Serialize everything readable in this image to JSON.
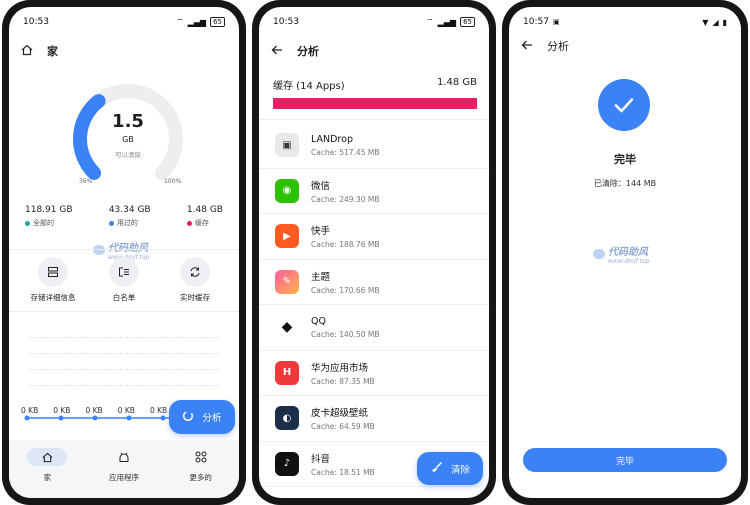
{
  "phone1": {
    "status_time": "10:53",
    "battery": "65",
    "header_title": "家",
    "gauge": {
      "value": "1.5",
      "unit": "GB",
      "caption": "可以清除",
      "left_label": "36%",
      "right_label": "100%",
      "fill_fraction": 0.36,
      "color": "#3b82f6",
      "track_color": "#eeeeee"
    },
    "stats": [
      {
        "value": "118.91 GB",
        "label": "全部的",
        "color": "#26a69a"
      },
      {
        "value": "43.34 GB",
        "label": "用过的",
        "color": "#3b82f6"
      },
      {
        "value": "1.48 GB",
        "label": "缓存",
        "color": "#e91e63"
      }
    ],
    "quick_actions": [
      {
        "label": "存储详细信息",
        "icon": "storage-icon"
      },
      {
        "label": "白名单",
        "icon": "whitelist-icon"
      },
      {
        "label": "实时缓存",
        "icon": "refresh-icon"
      }
    ],
    "kb_labels": [
      "0 KB",
      "0 KB",
      "0 KB",
      "0 KB",
      "0 KB"
    ],
    "fab_label": "分析",
    "nav": [
      {
        "label": "家",
        "icon": "home-icon",
        "active": true
      },
      {
        "label": "应用程序",
        "icon": "android-icon",
        "active": false
      },
      {
        "label": "更多的",
        "icon": "grid-icon",
        "active": false
      }
    ]
  },
  "phone2": {
    "status_time": "10:53",
    "battery": "65",
    "title": "分析",
    "cache_label": "缓存 (14 Apps)",
    "cache_total": "1.48 GB",
    "apps": [
      {
        "name": "LANDrop",
        "size": "Cache: 517.45 MB",
        "color": "#e8e8e8",
        "glyph": "▣"
      },
      {
        "name": "微信",
        "size": "Cache: 249.30 MB",
        "color": "#2dc100",
        "glyph": "◉"
      },
      {
        "name": "快手",
        "size": "Cache: 188.76 MB",
        "color": "#ff5a1f",
        "glyph": "▶"
      },
      {
        "name": "主题",
        "size": "Cache: 170.66 MB",
        "color": "#ff6f91",
        "glyph": "✎"
      },
      {
        "name": "QQ",
        "size": "Cache: 140.50 MB",
        "color": "#ffffff",
        "glyph": "◆"
      },
      {
        "name": "华为应用市场",
        "size": "Cache: 87.35 MB",
        "color": "#ee3a3a",
        "glyph": "H"
      },
      {
        "name": "皮卡超级壁纸",
        "size": "Cache: 64.59 MB",
        "color": "#1c2f4a",
        "glyph": "◐"
      },
      {
        "name": "抖音",
        "size": "Cache: 18.51 MB",
        "color": "#111111",
        "glyph": "♪"
      }
    ],
    "fab_label": "清除"
  },
  "phone3": {
    "status_time": "10:57",
    "title": "分析",
    "done_title": "完毕",
    "cleared_text": "已清除：144 MB",
    "button_label": "完毕"
  },
  "watermark": {
    "line1": "代码助风",
    "line2": "www.dmjf.top"
  }
}
